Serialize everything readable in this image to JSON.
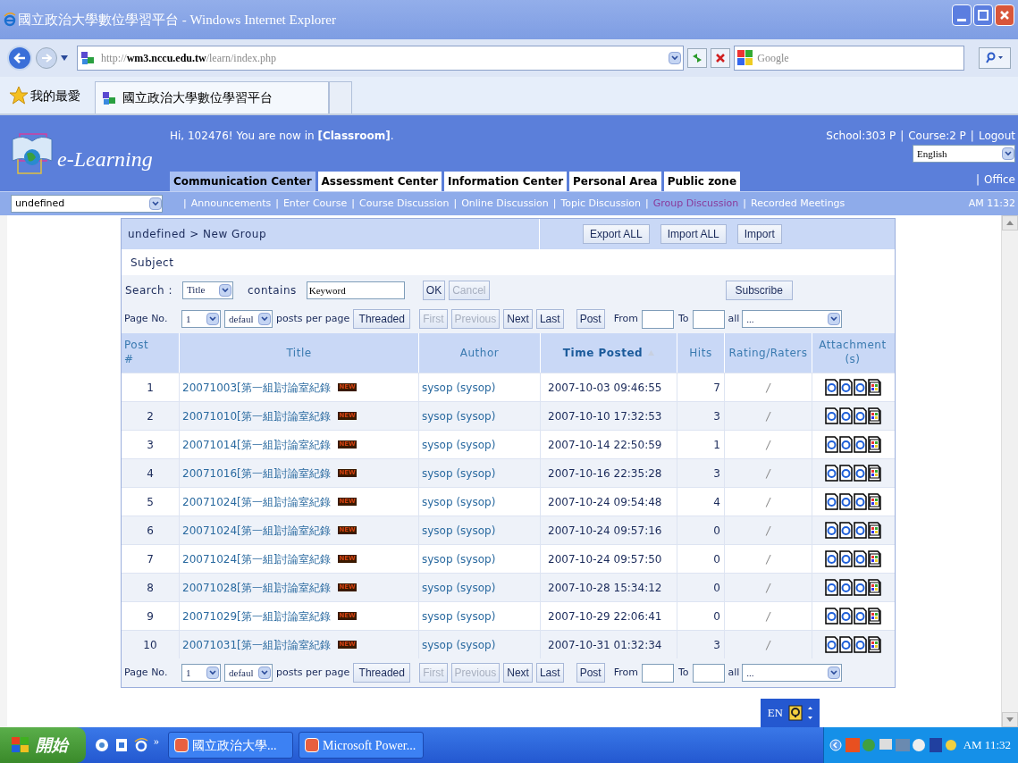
{
  "window": {
    "title": "國立政治大學數位學習平台 - Windows Internet Explorer"
  },
  "address_bar": {
    "url": "http://**wm3.nccu.edu.tw**/learn/index.php",
    "search_placeholder": "Google"
  },
  "favorites_bar": {
    "label": "我的最愛",
    "tab": "國立政治大學數位學習平台"
  },
  "site": {
    "logo_text": "e-Learning",
    "greeting": "Hi, 102476! You are now in **[Classroom]**.",
    "links": [
      "School:303 P",
      "Course:2 P",
      "Logout"
    ],
    "separator": "|",
    "language": "English",
    "office": "Office",
    "course_select": "undefined",
    "time": "AM 11:32",
    "tabs": [
      {
        "label": "Communication Center",
        "selected": true
      },
      {
        "label": "Assessment Center",
        "selected": false
      },
      {
        "label": "Information Center",
        "selected": false
      },
      {
        "label": "Personal Area",
        "selected": false
      },
      {
        "label": "Public zone",
        "selected": false
      }
    ],
    "subnav": [
      {
        "label": "Announcements",
        "selected": false
      },
      {
        "label": "Enter Course",
        "selected": false
      },
      {
        "label": "Course Discussion",
        "selected": false
      },
      {
        "label": "Online Discussion",
        "selected": false
      },
      {
        "label": "Topic Discussion",
        "selected": false
      },
      {
        "label": "Group Discussion",
        "selected": true
      },
      {
        "label": "Recorded Meetings",
        "selected": false
      }
    ]
  },
  "panel": {
    "breadcrumb": "undefined > New Group",
    "buttons": [
      "Export ALL",
      "Import ALL",
      "Import"
    ],
    "subject_label": "Subject",
    "search": {
      "label": "Search :",
      "field": "Title",
      "contains": "contains",
      "keyword": "Keyword",
      "ok": "OK",
      "cancel": "Cancel",
      "cancel_disabled": true,
      "subscribe": "Subscribe"
    },
    "pagers": [
      {
        "page_label": "Page No.",
        "page": "1",
        "per_page": "defaul",
        "per_page_label": "posts per page",
        "threaded": "Threaded",
        "nav": [
          {
            "label": "First",
            "disabled": true
          },
          {
            "label": "Previous",
            "disabled": true
          },
          {
            "label": "Next",
            "disabled": false
          },
          {
            "label": "Last",
            "disabled": false
          }
        ],
        "post": "Post",
        "from": "From",
        "to": "To",
        "all": "all",
        "range": "..."
      },
      {
        "page_label": "Page No.",
        "page": "1",
        "per_page": "defaul",
        "per_page_label": "posts per page",
        "threaded": "Threaded",
        "nav": [
          {
            "label": "First",
            "disabled": true
          },
          {
            "label": "Previous",
            "disabled": true
          },
          {
            "label": "Next",
            "disabled": false
          },
          {
            "label": "Last",
            "disabled": false
          }
        ],
        "post": "Post",
        "from": "From",
        "to": "To",
        "all": "all",
        "range": "..."
      }
    ],
    "columns": [
      {
        "label": "Post #",
        "sorted": false
      },
      {
        "label": "Title",
        "sorted": false
      },
      {
        "label": "Author",
        "sorted": false
      },
      {
        "label": "Time Posted",
        "sorted": true
      },
      {
        "label": "Hits",
        "sorted": false
      },
      {
        "label": "Rating/Raters",
        "sorted": false
      },
      {
        "label": "Attachment (s)",
        "sorted": false
      }
    ],
    "rows": [
      {
        "no": "1",
        "title": "20071003[第一組]討論室紀錄",
        "badge": "NEW",
        "author": "sysop (sysop)",
        "time": "2007-10-03 09:46:55",
        "hits": "7",
        "rating": "/"
      },
      {
        "no": "2",
        "title": "20071010[第一組]討論室紀錄",
        "badge": "NEW",
        "author": "sysop (sysop)",
        "time": "2007-10-10 17:32:53",
        "hits": "3",
        "rating": "/"
      },
      {
        "no": "3",
        "title": "20071014[第一組]討論室紀錄",
        "badge": "NEW",
        "author": "sysop (sysop)",
        "time": "2007-10-14 22:50:59",
        "hits": "1",
        "rating": "/"
      },
      {
        "no": "4",
        "title": "20071016[第一組]討論室紀錄",
        "badge": "NEW",
        "author": "sysop (sysop)",
        "time": "2007-10-16 22:35:28",
        "hits": "3",
        "rating": "/"
      },
      {
        "no": "5",
        "title": "20071024[第一組]討論室紀錄",
        "badge": "NEW",
        "author": "sysop (sysop)",
        "time": "2007-10-24 09:54:48",
        "hits": "4",
        "rating": "/"
      },
      {
        "no": "6",
        "title": "20071024[第一組]討論室紀錄",
        "badge": "NEW",
        "author": "sysop (sysop)",
        "time": "2007-10-24 09:57:16",
        "hits": "0",
        "rating": "/"
      },
      {
        "no": "7",
        "title": "20071024[第一組]討論室紀錄",
        "badge": "NEW",
        "author": "sysop (sysop)",
        "time": "2007-10-24 09:57:50",
        "hits": "0",
        "rating": "/"
      },
      {
        "no": "8",
        "title": "20071028[第一組]討論室紀錄",
        "badge": "NEW",
        "author": "sysop (sysop)",
        "time": "2007-10-28 15:34:12",
        "hits": "0",
        "rating": "/"
      },
      {
        "no": "9",
        "title": "20071029[第一組]討論室紀錄",
        "badge": "NEW",
        "author": "sysop (sysop)",
        "time": "2007-10-29 22:06:41",
        "hits": "0",
        "rating": "/"
      },
      {
        "no": "10",
        "title": "20071031[第一組]討論室紀錄",
        "badge": "NEW",
        "author": "sysop (sysop)",
        "time": "2007-10-31 01:32:34",
        "hits": "3",
        "rating": "/"
      }
    ]
  },
  "language_bar": {
    "label": "EN"
  },
  "taskbar": {
    "start": "開始",
    "chevron": "»",
    "tasks": [
      "國立政治大學...",
      "Microsoft Power..."
    ],
    "time": "AM 11:32"
  }
}
